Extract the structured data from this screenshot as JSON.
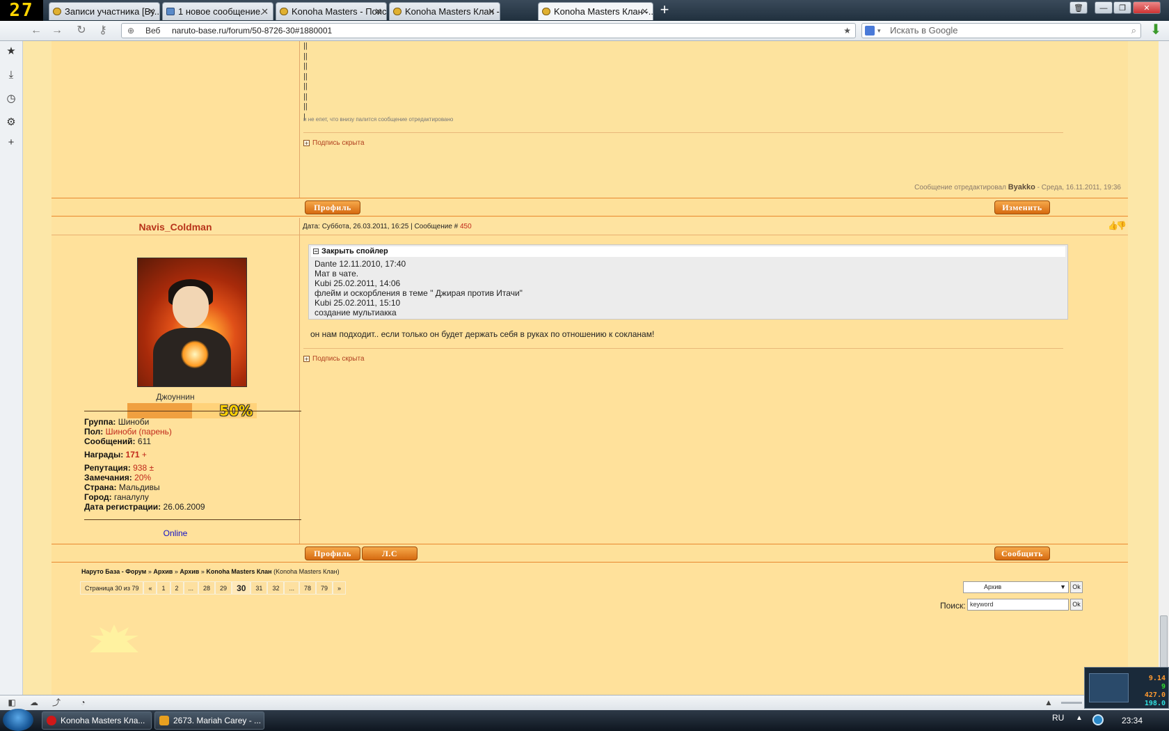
{
  "browser": {
    "badge": "27",
    "tabs": [
      {
        "label": "Записи участника [By...",
        "icon": "naruto-favicon",
        "active": false
      },
      {
        "label": "1 новое сообщение.",
        "icon": "message-favicon",
        "active": false
      },
      {
        "label": "Konoha Masters - Поиск",
        "icon": "naruto-favicon",
        "active": false
      },
      {
        "label": "Konoha Masters Клан -...",
        "icon": "naruto-favicon",
        "active": false
      },
      {
        "label": "Konoha Masters Клан -...",
        "icon": "naruto-favicon",
        "active": true
      }
    ],
    "address": {
      "scope_label": "Веб",
      "url": "naruto-base.ru/forum/50-8726-30#1880001"
    },
    "search_placeholder": "Искать в Google"
  },
  "forum": {
    "prev_post": {
      "quote_bars": [
        "||",
        "||",
        "||",
        "||",
        "||",
        "||",
        "||",
        "|"
      ],
      "note": "и не епет, что внизу палится сообщение отредактировано",
      "signature_label": "Подпись скрыта",
      "edited_prefix": "Сообщение отредактировал",
      "edited_by": "Byakko",
      "edited_date": "- Среда, 16.11.2011, 19:36",
      "profile_button": "Профиль",
      "edit_button": "Изменить"
    },
    "post": {
      "author": "Navis_Coldman",
      "header": "Дата: Суббота, 26.03.2011, 16:25 | Сообщение #",
      "message_number": "450",
      "rank": "Джоуннин",
      "rank_percent": "50%",
      "rank_progress": 0.5,
      "info": {
        "group_label": "Группа:",
        "group": "Шиноби",
        "gender_label": "Пол:",
        "gender": "Шиноби (парень)",
        "messages_label": "Сообщений:",
        "messages": "611",
        "awards_label": "Награды:",
        "awards": "171",
        "awards_plus": "+",
        "reputation_label": "Репутация:",
        "reputation": "938",
        "reputation_pm": "±",
        "warnings_label": "Замечания:",
        "warnings": "20%",
        "country_label": "Страна:",
        "country": "Мальдивы",
        "city_label": "Город:",
        "city": "ганалулу",
        "registered_label": "Дата регистрации:",
        "registered": "26.06.2009"
      },
      "online": "Online",
      "spoiler_title": "Закрыть спойлер",
      "spoiler_lines": [
        "Dante 12.11.2010, 17:40",
        "Мат в чате.",
        "Kubi 25.02.2011, 14:06",
        "флейм и оскорбления в теме \" Джирая против Итачи\"",
        "Kubi 25.02.2011, 15:10",
        "создание мультиакка"
      ],
      "text": "он нам подходит.. если только он будет держать себя в руках по отношению к сокланам!",
      "signature_label": "Подпись скрыта",
      "profile_button": "Профиль",
      "pm_button": "Л.С",
      "reply_button": "Сообщить"
    },
    "breadcrumb": {
      "items": [
        "Наруто База - Форум",
        "Архив",
        "Архив",
        "Konoha Masters Клан"
      ],
      "separator": "»",
      "tail": "(Konoha Masters Клан)"
    },
    "pager": {
      "label": "Страница 30 из 79",
      "items": [
        "«",
        "1",
        "2",
        "...",
        "28",
        "29",
        "30",
        "31",
        "32",
        "...",
        "78",
        "79",
        "»"
      ],
      "current": "30"
    },
    "jump": {
      "selected": "Архив",
      "ok": "Ok"
    },
    "search": {
      "label": "Поиск:",
      "value": "keyword",
      "ok": "Ok"
    }
  },
  "taskbar": {
    "tasks": [
      "Konoha Masters Кла...",
      "2673. Mariah Carey - ..."
    ],
    "lang": "RU",
    "clock": "23:34"
  },
  "monitor": [
    "9.14",
    "9",
    "427.0",
    "198.0"
  ]
}
